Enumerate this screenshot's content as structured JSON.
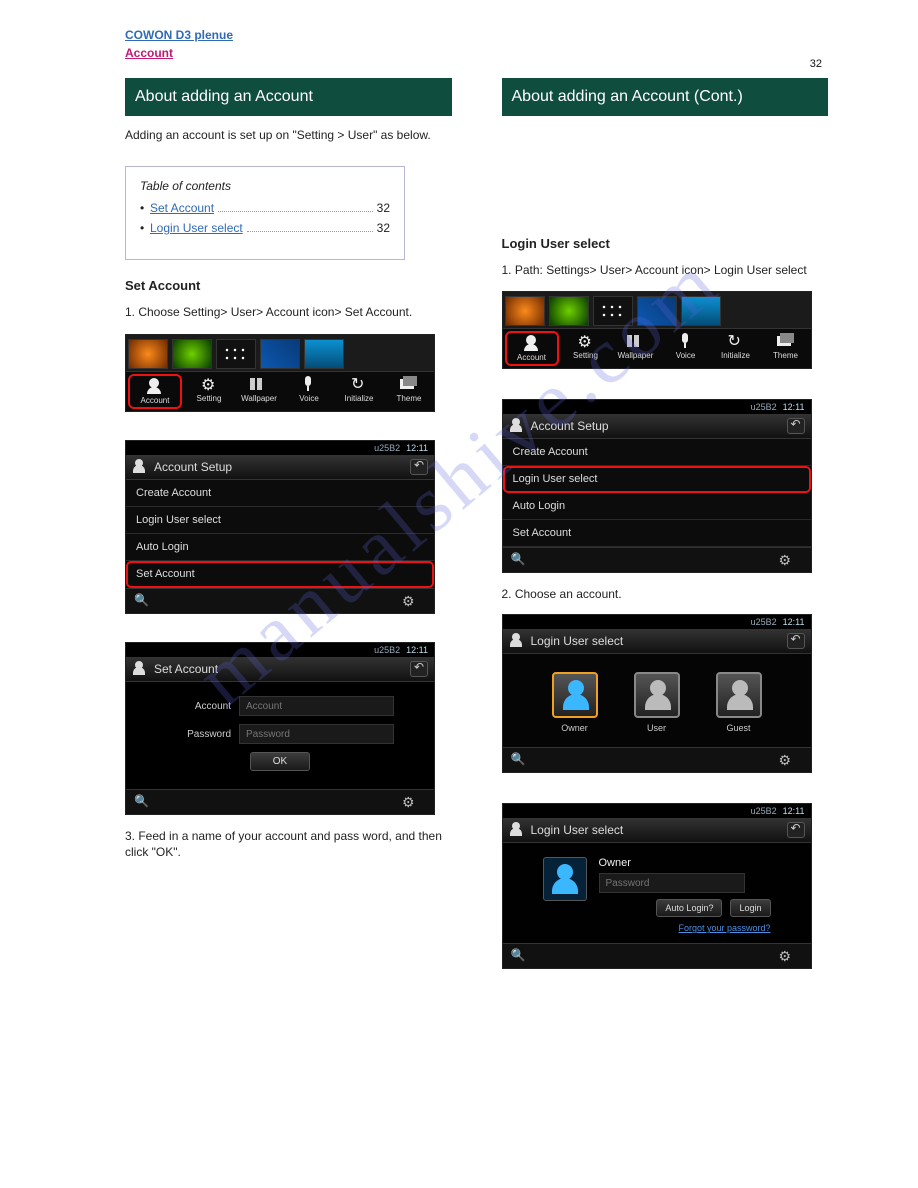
{
  "page_number": "32",
  "watermark": "manualshive.com",
  "top_links": {
    "l1": "COWON D3 plenue",
    "l2": "Account"
  },
  "left": {
    "heading": "About adding an Account",
    "intro": "Adding an account is set up on \"Setting > User\" as below.",
    "toc": {
      "head": "Table of contents",
      "items": [
        {
          "label": "Set Account",
          "page": "32"
        },
        {
          "label": "Login User select",
          "page": "32"
        }
      ]
    },
    "sub1": "Set Account",
    "step1": "1. Choose Setting> User> Account icon> Set Account.",
    "step3": "3. Feed in a name of your account and pass word, and then click \"OK\"."
  },
  "right": {
    "heading": "About adding an Account (Cont.)",
    "sub": "Login User select",
    "step1": "1. Path: Settings> User> Account icon> Login User select",
    "step2": "2. Choose an account."
  },
  "launcher": {
    "items": [
      "Account",
      "Setting",
      "Wallpaper",
      "Voice",
      "Initialize",
      "Theme"
    ]
  },
  "screens": {
    "time": "12:11",
    "acct_setup_title": "Account Setup",
    "acct_items": [
      "Create Account",
      "Login User select",
      "Auto Login",
      "Set Account"
    ],
    "set_acct_title": "Set Account",
    "set_acct": {
      "acct_label": "Account",
      "acct_ph": "Account",
      "pw_label": "Password",
      "pw_ph": "Password",
      "ok": "OK"
    },
    "login_sel_title": "Login User select",
    "users": [
      "Owner",
      "User",
      "Guest"
    ],
    "login_box": {
      "name": "Owner",
      "pw_ph": "Password",
      "auto": "Auto Login?",
      "login": "Login",
      "forgot": "Forgot your password?"
    }
  }
}
